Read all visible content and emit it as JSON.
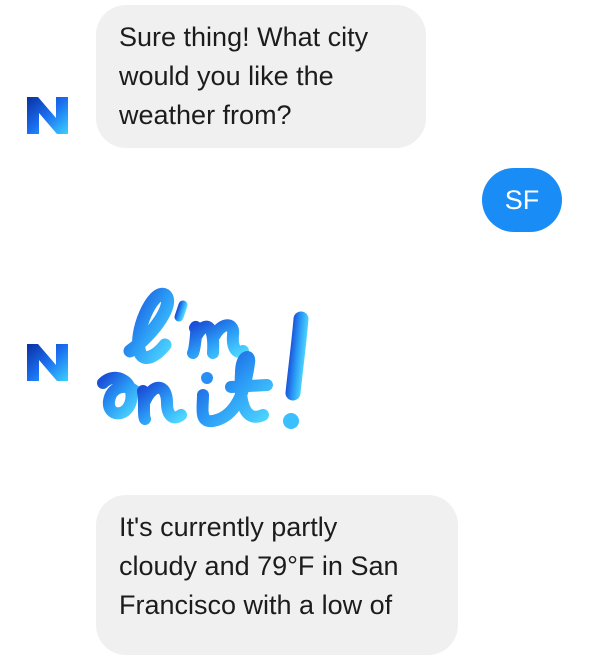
{
  "messages": [
    {
      "from": "bot",
      "text": "Sure thing! What city\nwould you like the\nweather from?"
    },
    {
      "from": "user",
      "text": "SF"
    },
    {
      "from": "bot",
      "sticker": "im-on-it-sticker",
      "sticker_text": "I'm on it!"
    },
    {
      "from": "bot",
      "text": "It's currently partly\ncloudy and 79°F in San\nFrancisco with a low of"
    }
  ],
  "colors": {
    "user_bubble": "#1a8cf5",
    "bot_bubble": "#f0f0f0",
    "brand": "#1e6fe8"
  },
  "icons": {
    "bot_avatar": "m-assistant-logo-icon"
  }
}
